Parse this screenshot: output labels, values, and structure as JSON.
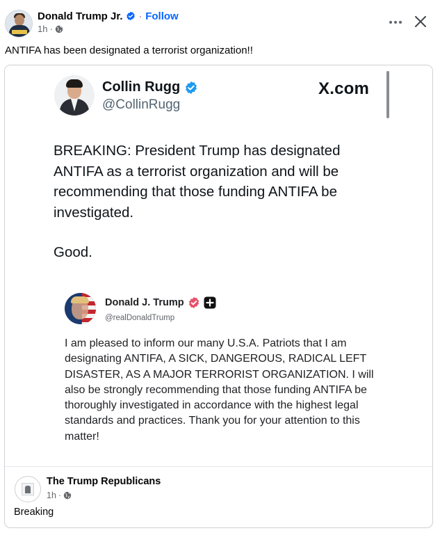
{
  "post": {
    "author": "Donald Trump Jr.",
    "follow_label": "Follow",
    "separator": "·",
    "time": "1h",
    "meta_separator": "·",
    "caption": "ANTIFA has been designated a terrorist organization!!"
  },
  "shared_image": {
    "tweet": {
      "name": "Collin Rugg",
      "handle": "@CollinRugg",
      "source": "X.com",
      "text": "BREAKING: President Trump has designated ANTIFA as a terrorist organization and will be recommending that those funding ANTIFA be investigated.",
      "text2": "Good."
    },
    "truth": {
      "name": "Donald J. Trump",
      "handle": "@realDonaldTrump",
      "text": "I am pleased to inform our many U.S.A. Patriots that I am designating ANTIFA, A SICK, DANGEROUS, RADICAL LEFT DISASTER, AS A MAJOR TERRORIST ORGANIZATION. I will also be strongly recommending that those funding ANTIFA be thoroughly investigated in accordance with the highest legal standards and practices. Thank you for your attention to this matter!"
    }
  },
  "shared_from": {
    "page_name": "The Trump Republicans",
    "time": "1h",
    "separator": "·",
    "text": "Breaking"
  },
  "colors": {
    "facebook_blue": "#0866ff",
    "verified_blue": "#1d9bf0",
    "truth_verified": "#e8516a",
    "secondary_text": "#65676b"
  },
  "icons": [
    "verified-badge-icon",
    "globe-icon",
    "more-options-icon",
    "close-icon",
    "truth-plus-icon"
  ]
}
